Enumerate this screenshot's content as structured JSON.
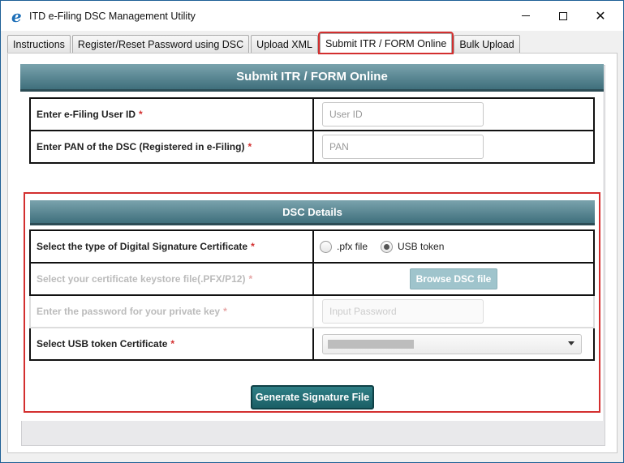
{
  "window": {
    "title": "ITD e-Filing DSC Management Utility",
    "icon": "e"
  },
  "tabs": [
    {
      "label": "Instructions"
    },
    {
      "label": "Register/Reset Password using DSC"
    },
    {
      "label": "Upload XML"
    },
    {
      "label": "Submit ITR / FORM Online",
      "active": true
    },
    {
      "label": "Bulk Upload"
    }
  ],
  "form": {
    "header": "Submit ITR / FORM Online",
    "user_id_label": "Enter e-Filing User ID",
    "user_id_placeholder": "User ID",
    "pan_label": "Enter PAN of the DSC (Registered in e-Filing)",
    "pan_placeholder": "PAN",
    "required_mark": "*"
  },
  "dsc": {
    "header": "DSC Details",
    "type_label": "Select the type of Digital Signature Certificate",
    "options": [
      "pfx file",
      "USB token"
    ],
    "selected_option": "USB token",
    "keystore_label": "Select your certificate keystore file(.PFX/P12)",
    "browse_label": "Browse DSC file",
    "password_label": "Enter the password for your private key",
    "password_placeholder": "Input Password",
    "usb_cert_label": "Select USB token Certificate"
  },
  "actions": {
    "generate_label": "Generate Signature File"
  },
  "colors": {
    "header_teal": "#4f7f8b",
    "highlight_red": "#d32f2f",
    "generate_button": "#1f666d"
  }
}
